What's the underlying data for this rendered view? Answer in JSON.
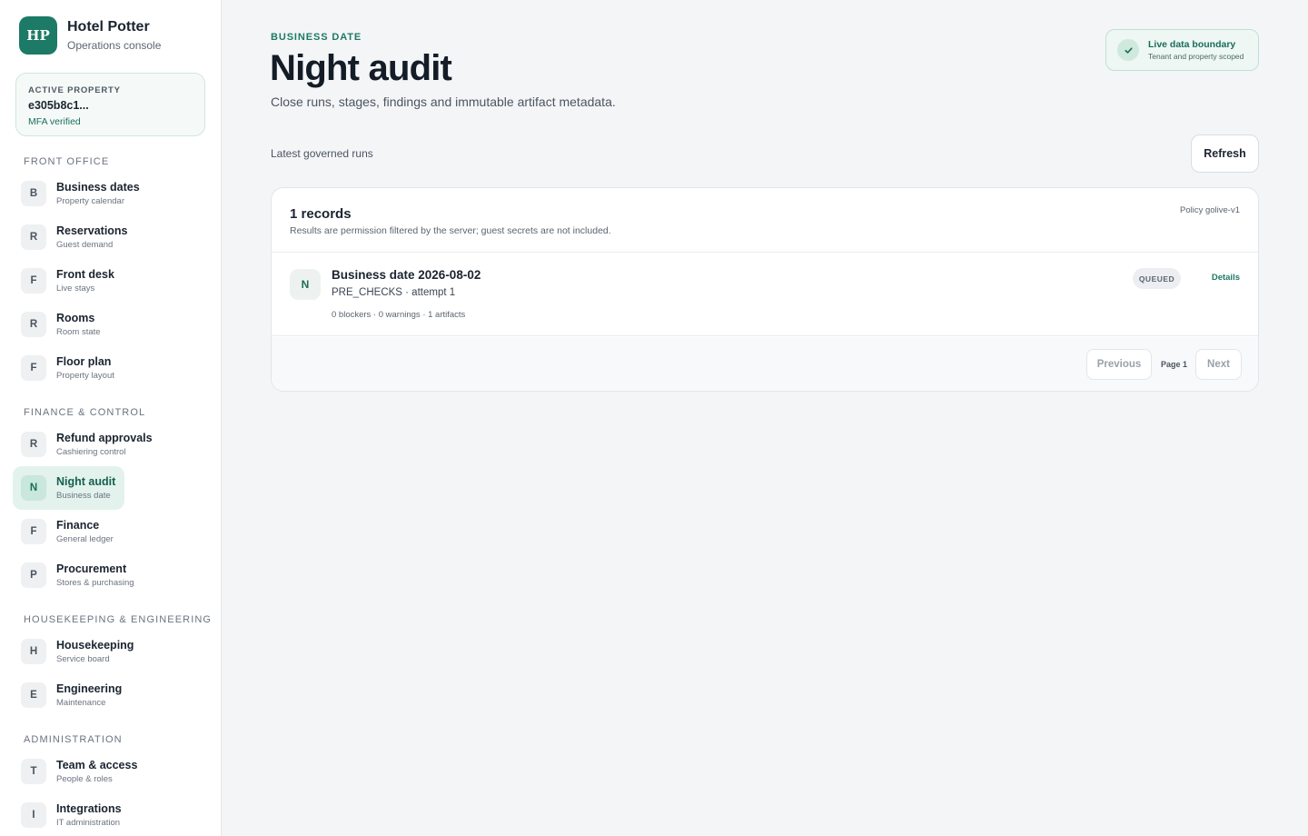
{
  "brand": {
    "logo": "HP",
    "name": "Hotel Potter",
    "subtitle": "Operations console"
  },
  "property": {
    "label": "ACTIVE PROPERTY",
    "id": "e305b8c1...",
    "mfa": "MFA verified"
  },
  "nav": {
    "sections": [
      {
        "title": "FRONT OFFICE",
        "items": [
          {
            "badge": "B",
            "label": "Business dates",
            "sub": "Property calendar"
          },
          {
            "badge": "R",
            "label": "Reservations",
            "sub": "Guest demand"
          },
          {
            "badge": "F",
            "label": "Front desk",
            "sub": "Live stays"
          },
          {
            "badge": "R",
            "label": "Rooms",
            "sub": "Room state"
          },
          {
            "badge": "F",
            "label": "Floor plan",
            "sub": "Property layout"
          }
        ]
      },
      {
        "title": "FINANCE & CONTROL",
        "items": [
          {
            "badge": "R",
            "label": "Refund approvals",
            "sub": "Cashiering control"
          },
          {
            "badge": "N",
            "label": "Night audit",
            "sub": "Business date",
            "active": true
          },
          {
            "badge": "F",
            "label": "Finance",
            "sub": "General ledger"
          },
          {
            "badge": "P",
            "label": "Procurement",
            "sub": "Stores & purchasing"
          }
        ]
      },
      {
        "title": "HOUSEKEEPING & ENGINEERING",
        "items": [
          {
            "badge": "H",
            "label": "Housekeeping",
            "sub": "Service board"
          },
          {
            "badge": "E",
            "label": "Engineering",
            "sub": "Maintenance"
          }
        ]
      },
      {
        "title": "ADMINISTRATION",
        "items": [
          {
            "badge": "T",
            "label": "Team & access",
            "sub": "People & roles"
          },
          {
            "badge": "I",
            "label": "Integrations",
            "sub": "IT administration"
          }
        ]
      }
    ]
  },
  "header": {
    "eyebrow": "BUSINESS DATE",
    "title": "Night audit",
    "subtitle": "Close runs, stages, findings and immutable artifact metadata."
  },
  "boundary": {
    "icon": "check-icon",
    "title": "Live data boundary",
    "subtitle": "Tenant and property scoped"
  },
  "runs": {
    "label": "Latest governed runs",
    "refresh_label": "Refresh",
    "count_text": "1 records",
    "note": "Results are permission filtered by the server; guest secrets are not included.",
    "policy": "Policy golive-v1",
    "items": [
      {
        "badge": "N",
        "title": "Business date 2026-08-02",
        "stage": "PRE_CHECKS · attempt 1",
        "meta": "0 blockers · 0 warnings · 1 artifacts",
        "status": "QUEUED",
        "details_label": "Details"
      }
    ]
  },
  "pagination": {
    "previous_label": "Previous",
    "page_label": "Page 1",
    "next_label": "Next"
  },
  "colors": {
    "brand": "#1c7a66",
    "active_nav_bg": "#e3f2ed",
    "page_bg": "#f4f5f6"
  }
}
